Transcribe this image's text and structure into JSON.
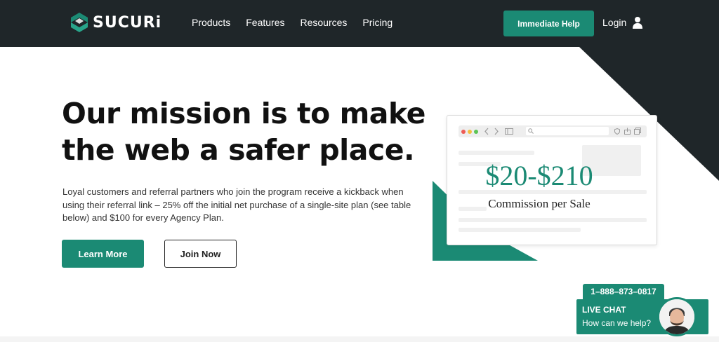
{
  "header": {
    "logo_text": "SUCURi",
    "nav": [
      "Products",
      "Features",
      "Resources",
      "Pricing"
    ],
    "help_button": "Immediate Help",
    "login_label": "Login",
    "icons": [
      "sucuri-logo-icon",
      "user-icon"
    ]
  },
  "hero": {
    "headline_line1": "Our mission is to make",
    "headline_line2": "the web a safer place.",
    "description": "Loyal customers and referral partners who join the program receive a kickback when using their referral link – 25% off the initial net purchase of a single-site plan (see table below) and $100 for every Agency Plan.",
    "learn_more": "Learn More",
    "join_now": "Join Now"
  },
  "promo": {
    "price": "$20-$210",
    "caption": "Commission per Sale"
  },
  "chat": {
    "phone": "1–888–873–0817",
    "title": "LIVE CHAT",
    "subtitle": "How can we help?"
  },
  "colors": {
    "brand_green": "#1b8a74",
    "header_dark": "#1f2629"
  }
}
